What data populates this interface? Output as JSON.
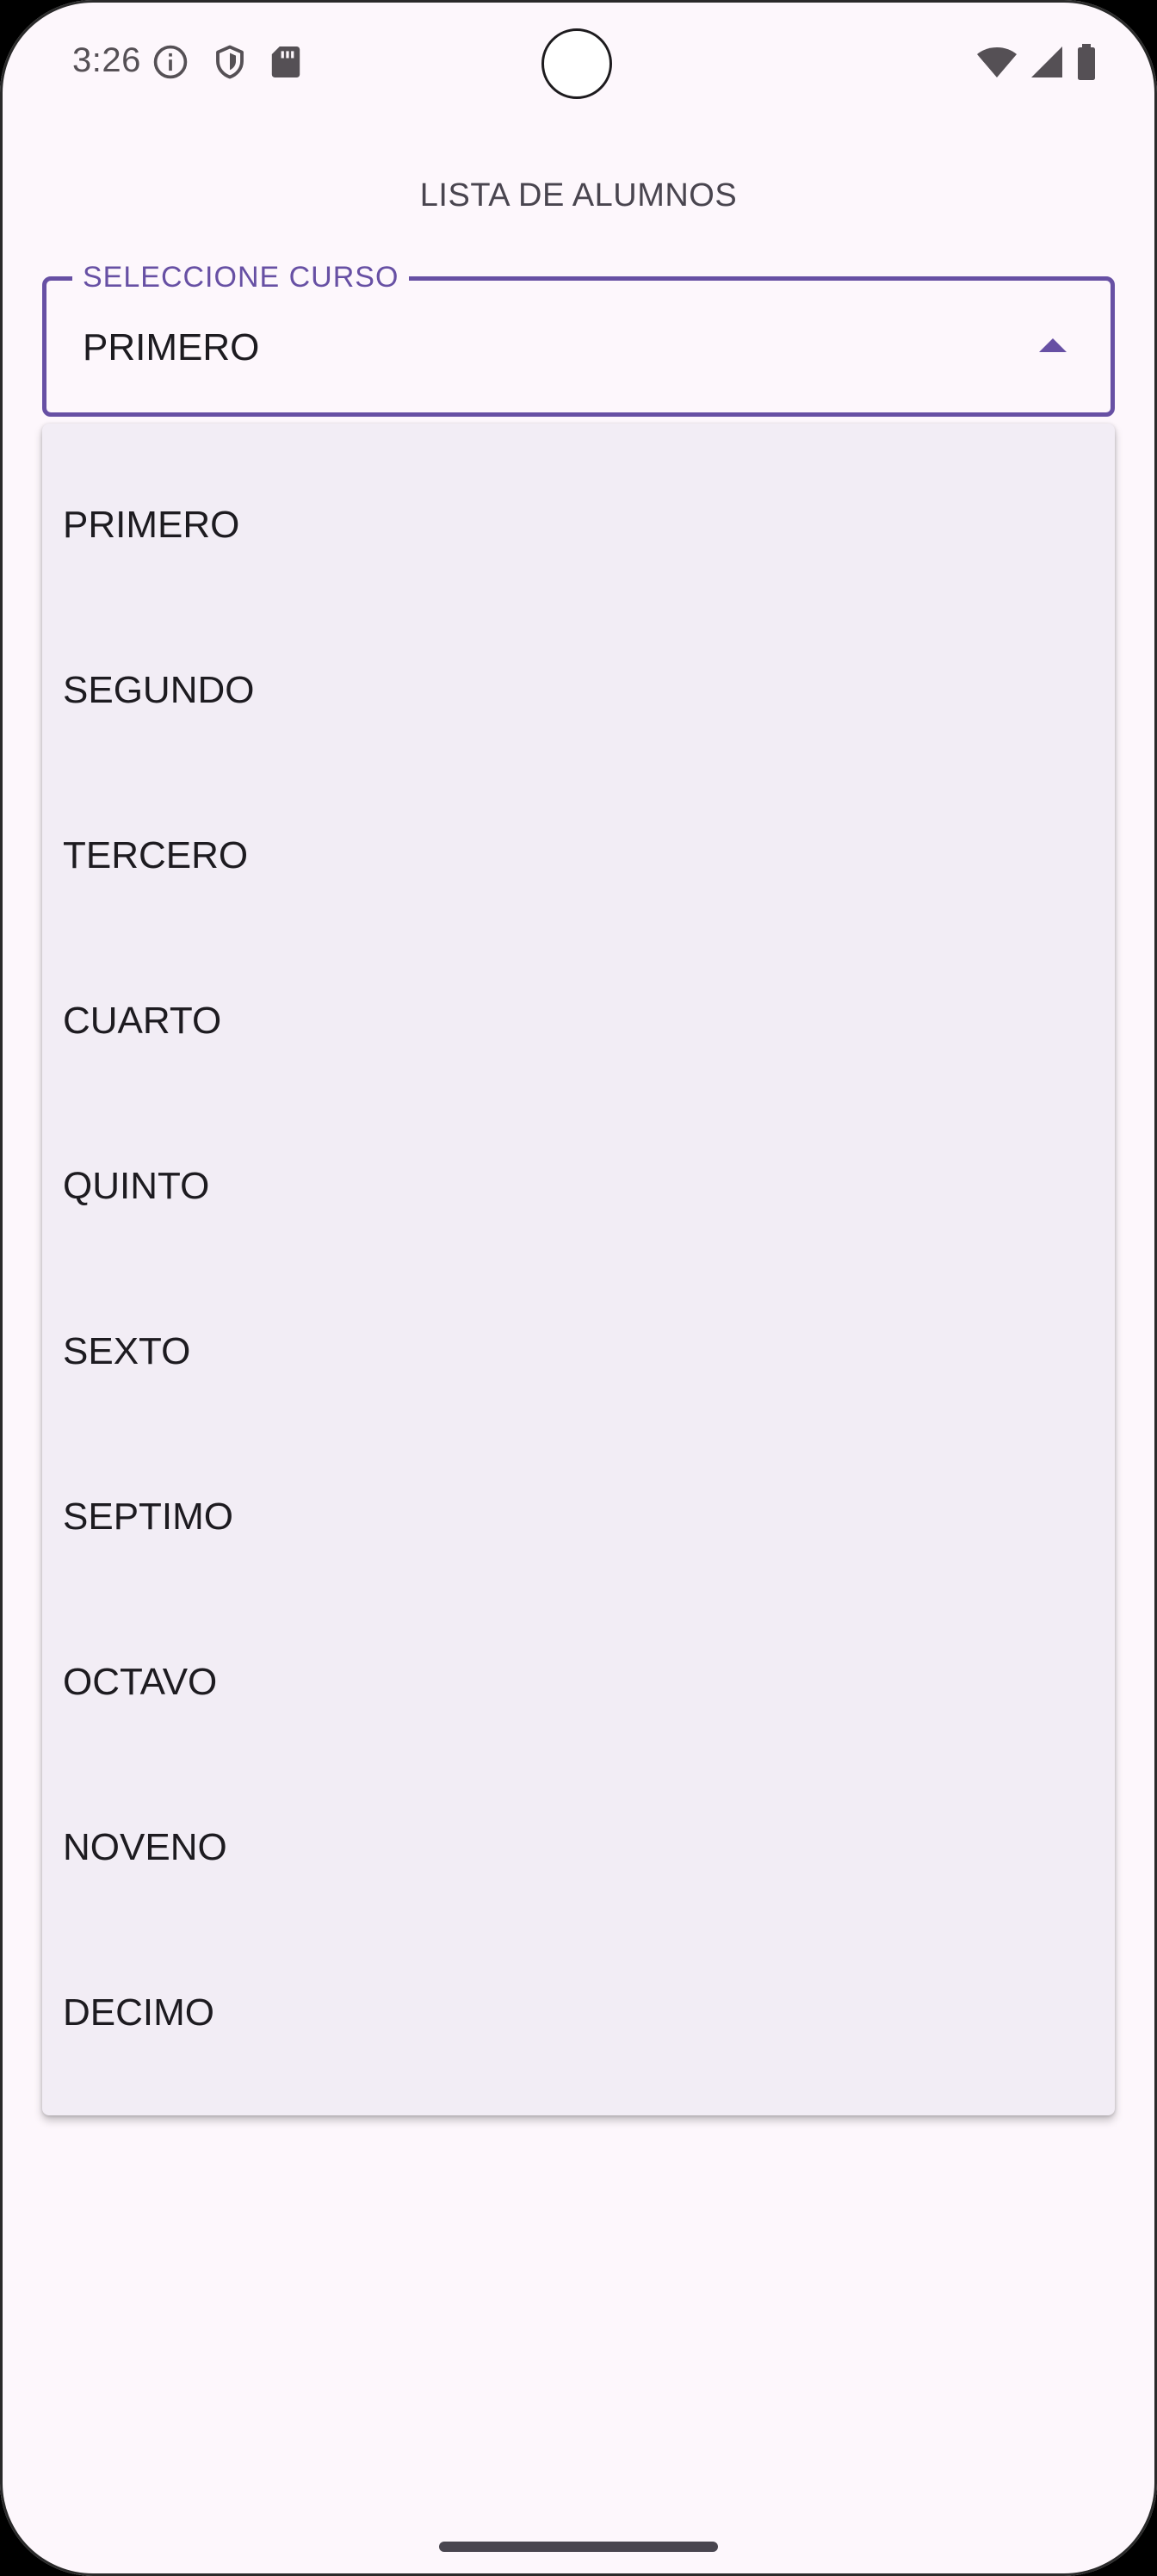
{
  "status_bar": {
    "time": "3:26",
    "left_icons": [
      "info-icon",
      "shield-icon",
      "sd-card-icon"
    ],
    "right_icons": [
      "wifi-icon",
      "cell-signal-icon",
      "battery-icon"
    ]
  },
  "header": {
    "title": "LISTA DE ALUMNOS"
  },
  "course_select": {
    "label": "SELECCIONE CURSO",
    "value": "PRIMERO",
    "expanded": true,
    "arrow_icon": "arrow-drop-up-icon",
    "accent_color": "#6750a4"
  },
  "menu": {
    "items": [
      {
        "label": "PRIMERO"
      },
      {
        "label": "SEGUNDO"
      },
      {
        "label": "TERCERO"
      },
      {
        "label": "CUARTO"
      },
      {
        "label": "QUINTO"
      },
      {
        "label": "SEXTO"
      },
      {
        "label": "SEPTIMO"
      },
      {
        "label": "OCTAVO"
      },
      {
        "label": "NOVENO"
      },
      {
        "label": "DECIMO"
      }
    ]
  },
  "colors": {
    "background": "#fdf7fc",
    "menu_background": "#f2edf5",
    "text": "#1d1b20",
    "accent": "#6750a4"
  }
}
